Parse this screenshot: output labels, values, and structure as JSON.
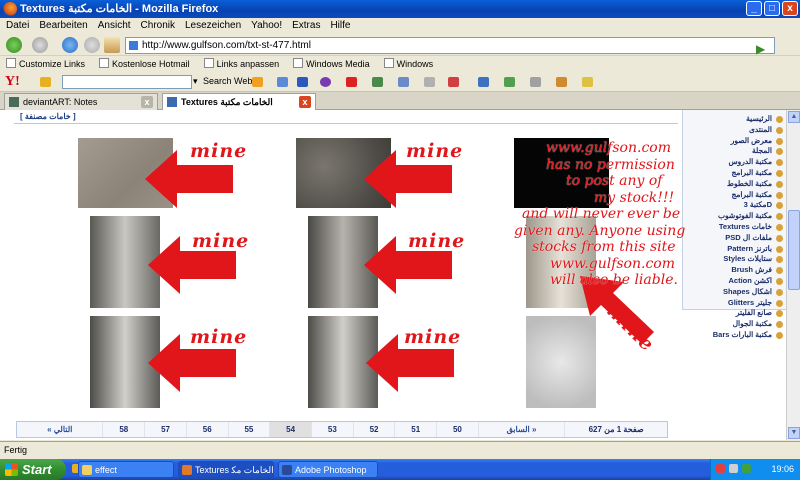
{
  "window": {
    "title": "Textures ﺍﻟﺨﺎﻣﺎﺕ ﻣﻜﺘﺒﺔ - Mozilla Firefox",
    "minimize": "_",
    "maximize": "□",
    "close": "x"
  },
  "menu": [
    "Datei",
    "Bearbeiten",
    "Ansicht",
    "Chronik",
    "Lesezeichen",
    "Yahoo!",
    "Extras",
    "Hilfe"
  ],
  "address": {
    "url": "http://www.gulfson.com/txt-st-477.html"
  },
  "bookmarks": [
    "Customize Links",
    "Kostenlose Hotmail",
    "Links anpassen",
    "Windows Media",
    "Windows"
  ],
  "yahoo": {
    "logo": "Y!",
    "search_label": "Search Web"
  },
  "tabs": [
    {
      "label": "deviantART: Notes",
      "active": false
    },
    {
      "label": "Textures ﺍﻟﺨﺎﻣﺎﺕ ﻣﻜﺘﺒﺔ",
      "active": true
    }
  ],
  "page": {
    "top_link": "[ ﺧﺎﻣﺎﺕ ﻣﺼﻨﻔﺔ ]",
    "mine_label": "mine",
    "sidebar": [
      "ﺍﻟﺮﺋﻴﺴﻴﺔ",
      "ﺍﻟﻤﻨﺘﺪﻯ",
      "ﻣﻌﺮﺽ ﺍﻟﺼﻮﺭ",
      "ﺍﻟﻤﺠﻠﺔ",
      "ﻣﻜﺘﺒﺔ ﺍﻟﺪﺭﻭﺱ",
      "ﻣﻜﺘﺒﺔ ﺍﻟﺒﺮﺍﻣﺞ",
      "ﻣﻜﺘﺒﺔ ﺍﻟﺨﻄﻮﻁ",
      "ﻣﻜﺘﺒﺔ ﺍﻟﺒﺮﺍﻣﺞ",
      "ﻣﻜﺘﺒﺔ 3D",
      "ﻣﻜﺘﺒﺔ ﺍﻟﻔﻮﺗﻮﺷﻮﺏ",
      "Textures ﺧﺎﻣﺎﺕ",
      "PSD ﻣﻠﻔﺎﺕ ﺍﻝ",
      "Pattern ﺑﺎﺗﺮﻧﺰ",
      "Styles ﺳﺘﺎﻳﻼﺕ",
      "Brush ﻓﺮﺵ",
      "Action ﺍﻛﺸﻦ",
      "Shapes ﺍﺷﻜﺎﻝ",
      "Glitters ﺟﻠﻴﺘﺮ",
      "ﺻﺎﻧﻊ ﺍﻟﻔﻠﻴﺘﺮ",
      "ﻣﻜﺘﺒﺔ ﺍﻟﺠﻮﺍﻝ",
      "Bars ﻣﻜﺘﺒﺔ ﺍﻟﺒﺎﺭﺍﺕ"
    ],
    "pager": {
      "next": "« ﺍﻟﺘﺎﻟﻲ",
      "pages": [
        "58",
        "57",
        "56",
        "55",
        "54",
        "53",
        "52",
        "51",
        "50"
      ],
      "current": "54",
      "prev": "ﺍﻟﺴﺎﺑﻖ »",
      "count": "627 ﺻﻔﺤﺔ 1 ﻣﻦ"
    }
  },
  "watermark_lines": [
    "www.gulfson.com",
    "has no permission",
    "to post any of",
    "my stock!!!",
    "and will never ever be",
    "given any. Anyone using",
    "stocks from this site",
    "www.gulfson.com",
    "will also be liable."
  ],
  "status": {
    "text": "Fertig"
  },
  "taskbar": {
    "start": "Start",
    "tasks": [
      "effect",
      "Textures ﺍﻟﺨﺎﻣﺎﺕ ﻣﻜ...",
      "Adobe Photoshop"
    ],
    "clock": "19:06"
  },
  "colors": {
    "mine_red": "#e0161a",
    "xp_blue": "#245edc",
    "start_green": "#2f8f2f"
  }
}
